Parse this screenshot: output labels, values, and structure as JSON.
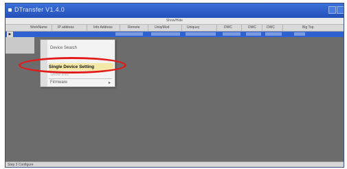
{
  "window": {
    "title": "DTransfer V1.4.0"
  },
  "strip": {
    "label": "Show/Hide"
  },
  "grid": {
    "columns": [
      "WorkName",
      "IP address",
      "Info Address",
      "Remote",
      "Uniq/Mod",
      "Uniquey",
      "DWC",
      "DWC",
      "DWC",
      "Big Top"
    ]
  },
  "selected_row": {
    "marker": "▶"
  },
  "context_menu": {
    "items": [
      {
        "label": "Device Search"
      },
      {
        "label": ""
      },
      {
        "label": "Single Device Setting"
      },
      {
        "label": "Show Info"
      },
      {
        "label": "Firmware"
      }
    ],
    "submenu_arrow": "▸"
  },
  "statusbar": {
    "text": "Step 3 Configure"
  },
  "colors": {
    "titlebar": "#2350b8",
    "selection": "#2f62d1",
    "highlight": "#f6e9a8",
    "annotation": "#e31a1a"
  }
}
